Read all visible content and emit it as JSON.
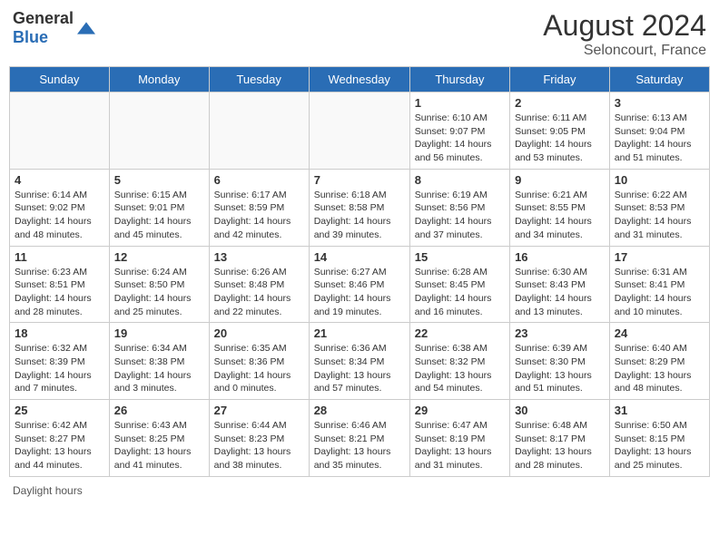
{
  "header": {
    "logo_general": "General",
    "logo_blue": "Blue",
    "month_year": "August 2024",
    "location": "Seloncourt, France"
  },
  "footer": {
    "daylight_label": "Daylight hours"
  },
  "days_of_week": [
    "Sunday",
    "Monday",
    "Tuesday",
    "Wednesday",
    "Thursday",
    "Friday",
    "Saturday"
  ],
  "weeks": [
    [
      {
        "day": "",
        "info": ""
      },
      {
        "day": "",
        "info": ""
      },
      {
        "day": "",
        "info": ""
      },
      {
        "day": "",
        "info": ""
      },
      {
        "day": "1",
        "info": "Sunrise: 6:10 AM\nSunset: 9:07 PM\nDaylight: 14 hours and 56 minutes."
      },
      {
        "day": "2",
        "info": "Sunrise: 6:11 AM\nSunset: 9:05 PM\nDaylight: 14 hours and 53 minutes."
      },
      {
        "day": "3",
        "info": "Sunrise: 6:13 AM\nSunset: 9:04 PM\nDaylight: 14 hours and 51 minutes."
      }
    ],
    [
      {
        "day": "4",
        "info": "Sunrise: 6:14 AM\nSunset: 9:02 PM\nDaylight: 14 hours and 48 minutes."
      },
      {
        "day": "5",
        "info": "Sunrise: 6:15 AM\nSunset: 9:01 PM\nDaylight: 14 hours and 45 minutes."
      },
      {
        "day": "6",
        "info": "Sunrise: 6:17 AM\nSunset: 8:59 PM\nDaylight: 14 hours and 42 minutes."
      },
      {
        "day": "7",
        "info": "Sunrise: 6:18 AM\nSunset: 8:58 PM\nDaylight: 14 hours and 39 minutes."
      },
      {
        "day": "8",
        "info": "Sunrise: 6:19 AM\nSunset: 8:56 PM\nDaylight: 14 hours and 37 minutes."
      },
      {
        "day": "9",
        "info": "Sunrise: 6:21 AM\nSunset: 8:55 PM\nDaylight: 14 hours and 34 minutes."
      },
      {
        "day": "10",
        "info": "Sunrise: 6:22 AM\nSunset: 8:53 PM\nDaylight: 14 hours and 31 minutes."
      }
    ],
    [
      {
        "day": "11",
        "info": "Sunrise: 6:23 AM\nSunset: 8:51 PM\nDaylight: 14 hours and 28 minutes."
      },
      {
        "day": "12",
        "info": "Sunrise: 6:24 AM\nSunset: 8:50 PM\nDaylight: 14 hours and 25 minutes."
      },
      {
        "day": "13",
        "info": "Sunrise: 6:26 AM\nSunset: 8:48 PM\nDaylight: 14 hours and 22 minutes."
      },
      {
        "day": "14",
        "info": "Sunrise: 6:27 AM\nSunset: 8:46 PM\nDaylight: 14 hours and 19 minutes."
      },
      {
        "day": "15",
        "info": "Sunrise: 6:28 AM\nSunset: 8:45 PM\nDaylight: 14 hours and 16 minutes."
      },
      {
        "day": "16",
        "info": "Sunrise: 6:30 AM\nSunset: 8:43 PM\nDaylight: 14 hours and 13 minutes."
      },
      {
        "day": "17",
        "info": "Sunrise: 6:31 AM\nSunset: 8:41 PM\nDaylight: 14 hours and 10 minutes."
      }
    ],
    [
      {
        "day": "18",
        "info": "Sunrise: 6:32 AM\nSunset: 8:39 PM\nDaylight: 14 hours and 7 minutes."
      },
      {
        "day": "19",
        "info": "Sunrise: 6:34 AM\nSunset: 8:38 PM\nDaylight: 14 hours and 3 minutes."
      },
      {
        "day": "20",
        "info": "Sunrise: 6:35 AM\nSunset: 8:36 PM\nDaylight: 14 hours and 0 minutes."
      },
      {
        "day": "21",
        "info": "Sunrise: 6:36 AM\nSunset: 8:34 PM\nDaylight: 13 hours and 57 minutes."
      },
      {
        "day": "22",
        "info": "Sunrise: 6:38 AM\nSunset: 8:32 PM\nDaylight: 13 hours and 54 minutes."
      },
      {
        "day": "23",
        "info": "Sunrise: 6:39 AM\nSunset: 8:30 PM\nDaylight: 13 hours and 51 minutes."
      },
      {
        "day": "24",
        "info": "Sunrise: 6:40 AM\nSunset: 8:29 PM\nDaylight: 13 hours and 48 minutes."
      }
    ],
    [
      {
        "day": "25",
        "info": "Sunrise: 6:42 AM\nSunset: 8:27 PM\nDaylight: 13 hours and 44 minutes."
      },
      {
        "day": "26",
        "info": "Sunrise: 6:43 AM\nSunset: 8:25 PM\nDaylight: 13 hours and 41 minutes."
      },
      {
        "day": "27",
        "info": "Sunrise: 6:44 AM\nSunset: 8:23 PM\nDaylight: 13 hours and 38 minutes."
      },
      {
        "day": "28",
        "info": "Sunrise: 6:46 AM\nSunset: 8:21 PM\nDaylight: 13 hours and 35 minutes."
      },
      {
        "day": "29",
        "info": "Sunrise: 6:47 AM\nSunset: 8:19 PM\nDaylight: 13 hours and 31 minutes."
      },
      {
        "day": "30",
        "info": "Sunrise: 6:48 AM\nSunset: 8:17 PM\nDaylight: 13 hours and 28 minutes."
      },
      {
        "day": "31",
        "info": "Sunrise: 6:50 AM\nSunset: 8:15 PM\nDaylight: 13 hours and 25 minutes."
      }
    ]
  ]
}
